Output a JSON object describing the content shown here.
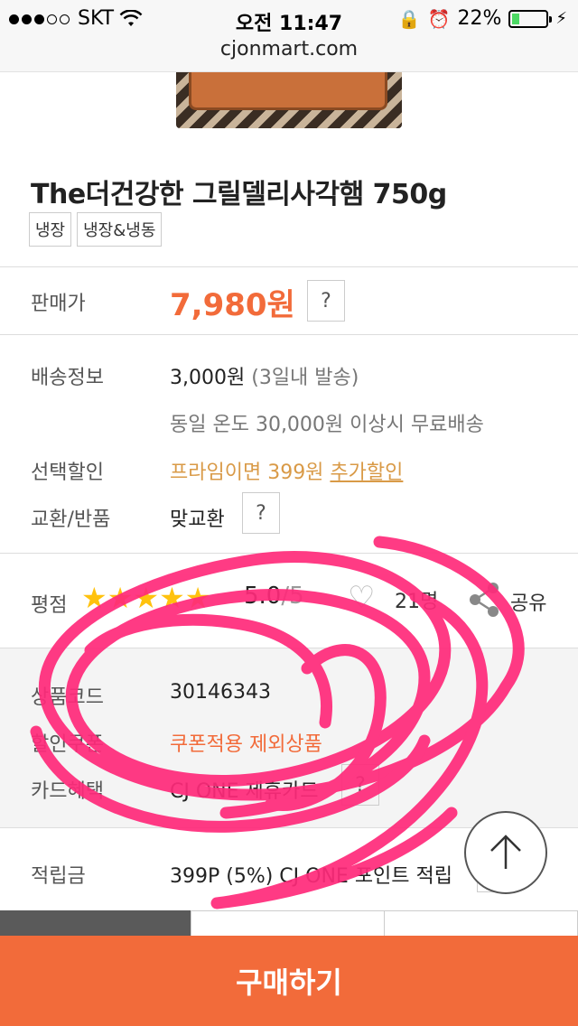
{
  "status_bar": {
    "carrier": "SKT",
    "time": "오전 11:47",
    "battery": "22%",
    "battery_level": 0.22
  },
  "browser": {
    "url": "cjonmart.com"
  },
  "product": {
    "title": "The더건강한 그릴델리사각햄 750g",
    "tags": [
      "냉장",
      "냉장&냉동"
    ]
  },
  "price_row": {
    "label": "판매가",
    "price": "7,980원",
    "help": "?"
  },
  "shipping": {
    "label": "배송정보",
    "fee": "3,000원",
    "eta": "(3일내 발송)",
    "free_note": "동일 온도 30,000원 이상시 무료배송"
  },
  "discount": {
    "label": "선택할인",
    "text": "프라임이면 399원",
    "link": "추가할인"
  },
  "exchange": {
    "label": "교환/반품",
    "value": "맞교환",
    "help": "?"
  },
  "rating": {
    "label": "평점",
    "stars": 5,
    "score": "5.0",
    "max": "/5",
    "count": "21명",
    "share_label": "공유"
  },
  "info": {
    "code_label": "상품코드",
    "code_value": "30146343",
    "coupon_label": "할인쿠폰",
    "coupon_value": "쿠폰적용 제외상품",
    "card_label": "카드혜택",
    "card_value": "CJ ONE 제휴카드",
    "card_help": "?"
  },
  "points": {
    "label": "적립금",
    "value": "399P (5%) CJ ONE 포인트 적립",
    "help": "?"
  },
  "buy_button": {
    "label": "구매하기"
  },
  "colors": {
    "accent": "#f26b3a",
    "star": "#ffc20e",
    "scribble": "#ff2a7a"
  }
}
